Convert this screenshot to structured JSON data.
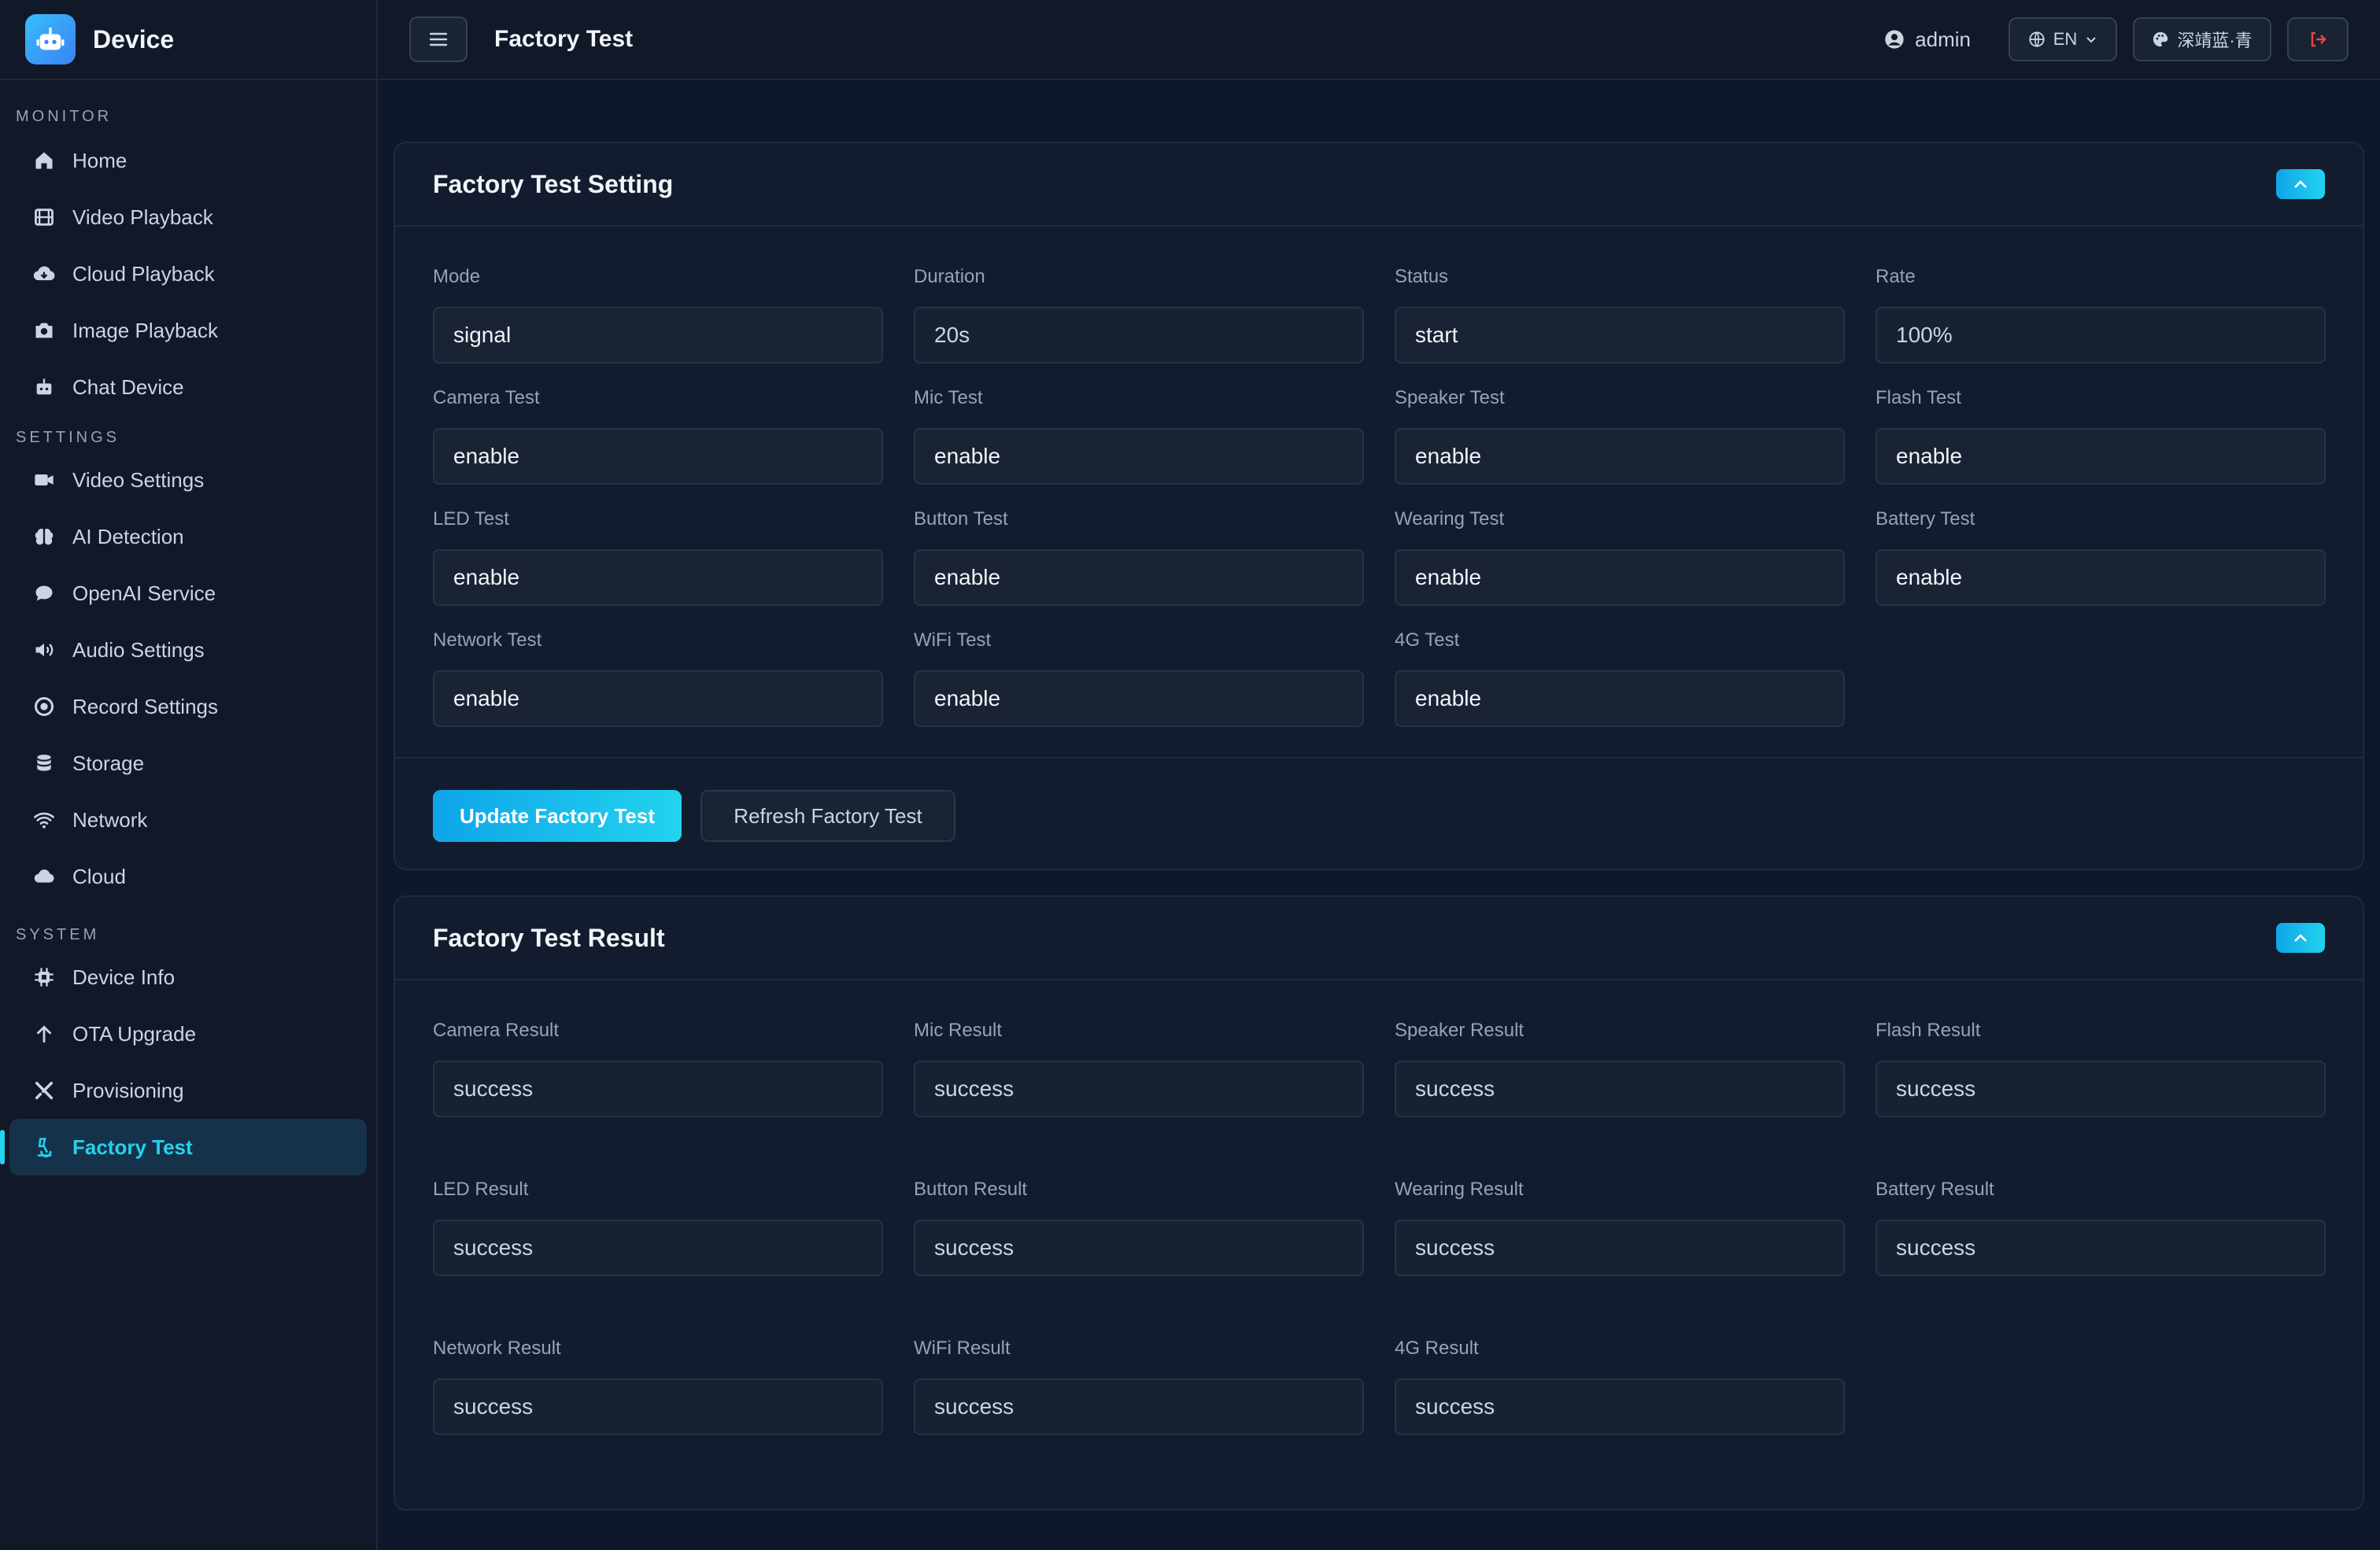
{
  "app": {
    "name": "Device"
  },
  "header": {
    "title": "Factory Test",
    "user": "admin",
    "language": "EN",
    "theme": "深靖蓝·青"
  },
  "sidebar": {
    "sections": [
      {
        "title": "MONITOR",
        "items": [
          {
            "label": "Home",
            "icon": "home-icon"
          },
          {
            "label": "Video Playback",
            "icon": "film-icon"
          },
          {
            "label": "Cloud Playback",
            "icon": "cloud-download-icon"
          },
          {
            "label": "Image Playback",
            "icon": "camera-icon"
          },
          {
            "label": "Chat Device",
            "icon": "robot-icon"
          }
        ]
      },
      {
        "title": "SETTINGS",
        "items": [
          {
            "label": "Video Settings",
            "icon": "video-icon"
          },
          {
            "label": "AI Detection",
            "icon": "brain-icon"
          },
          {
            "label": "OpenAI Service",
            "icon": "chat-icon"
          },
          {
            "label": "Audio Settings",
            "icon": "speaker-icon"
          },
          {
            "label": "Record Settings",
            "icon": "record-icon"
          },
          {
            "label": "Storage",
            "icon": "database-icon"
          },
          {
            "label": "Network",
            "icon": "wifi-icon"
          },
          {
            "label": "Cloud",
            "icon": "cloud-icon"
          }
        ]
      },
      {
        "title": "SYSTEM",
        "items": [
          {
            "label": "Device Info",
            "icon": "chip-icon"
          },
          {
            "label": "OTA Upgrade",
            "icon": "arrow-up-icon"
          },
          {
            "label": "Provisioning",
            "icon": "tools-icon"
          },
          {
            "label": "Factory Test",
            "icon": "flask-icon",
            "active": true
          }
        ]
      }
    ]
  },
  "setting": {
    "title": "Factory Test Setting",
    "fields": [
      {
        "label": "Mode",
        "value": "signal"
      },
      {
        "label": "Duration",
        "value": "20s"
      },
      {
        "label": "Status",
        "value": "start"
      },
      {
        "label": "Rate",
        "value": "100%"
      },
      {
        "label": "Camera Test",
        "value": "enable"
      },
      {
        "label": "Mic Test",
        "value": "enable"
      },
      {
        "label": "Speaker Test",
        "value": "enable"
      },
      {
        "label": "Flash Test",
        "value": "enable"
      },
      {
        "label": "LED Test",
        "value": "enable"
      },
      {
        "label": "Button Test",
        "value": "enable"
      },
      {
        "label": "Wearing Test",
        "value": "enable"
      },
      {
        "label": "Battery Test",
        "value": "enable"
      },
      {
        "label": "Network Test",
        "value": "enable"
      },
      {
        "label": "WiFi Test",
        "value": "enable"
      },
      {
        "label": "4G Test",
        "value": "enable"
      }
    ],
    "update_label": "Update Factory Test",
    "refresh_label": "Refresh Factory Test"
  },
  "result": {
    "title": "Factory Test Result",
    "fields": [
      {
        "label": "Camera Result",
        "value": "success"
      },
      {
        "label": "Mic Result",
        "value": "success"
      },
      {
        "label": "Speaker Result",
        "value": "success"
      },
      {
        "label": "Flash Result",
        "value": "success"
      },
      {
        "label": "LED Result",
        "value": "success"
      },
      {
        "label": "Button Result",
        "value": "success"
      },
      {
        "label": "Wearing Result",
        "value": "success"
      },
      {
        "label": "Battery Result",
        "value": "success"
      },
      {
        "label": "Network Result",
        "value": "success"
      },
      {
        "label": "WiFi Result",
        "value": "success"
      },
      {
        "label": "4G Result",
        "value": "success"
      }
    ]
  },
  "colors": {
    "accent": "#22d3ee",
    "background": "#0f172a",
    "logout": "#ef4444"
  }
}
